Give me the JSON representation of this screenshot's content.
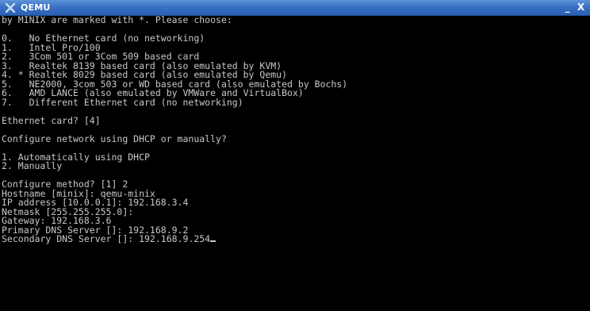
{
  "window": {
    "title": "QEMU",
    "minimize_label": "_",
    "close_label": "X"
  },
  "terminal": {
    "lines": [
      "by MINIX are marked with *. Please choose:",
      "",
      "0.   No Ethernet card (no networking)",
      "1.   Intel Pro/100",
      "2.   3Com 501 or 3Com 509 based card",
      "3.   Realtek 8139 based card (also emulated by KVM)",
      "4. * Realtek 8029 based card (also emulated by Qemu)",
      "5.   NE2000, 3com 503 or WD based card (also emulated by Bochs)",
      "6.   AMD LANCE (also emulated by VMWare and VirtualBox)",
      "7.   Different Ethernet card (no networking)",
      "",
      "Ethernet card? [4]",
      "",
      "Configure network using DHCP or manually?",
      "",
      "1. Automatically using DHCP",
      "2. Manually",
      "",
      "Configure method? [1] 2",
      "Hostname [minix]: qemu-minix",
      "IP address [10.0.0.1]: 192.168.3.4",
      "Netmask [255.255.255.0]:",
      "Gateway: 192.168.3.6",
      "Primary DNS Server []: 192.168.9.2",
      "Secondary DNS Server []: 192.168.9.254"
    ]
  },
  "colors": {
    "titlebar": "#3b71c3",
    "terminal_bg": "#000000",
    "terminal_fg": "#c8c8c8"
  },
  "icons": {
    "app": "qemu-icon"
  }
}
